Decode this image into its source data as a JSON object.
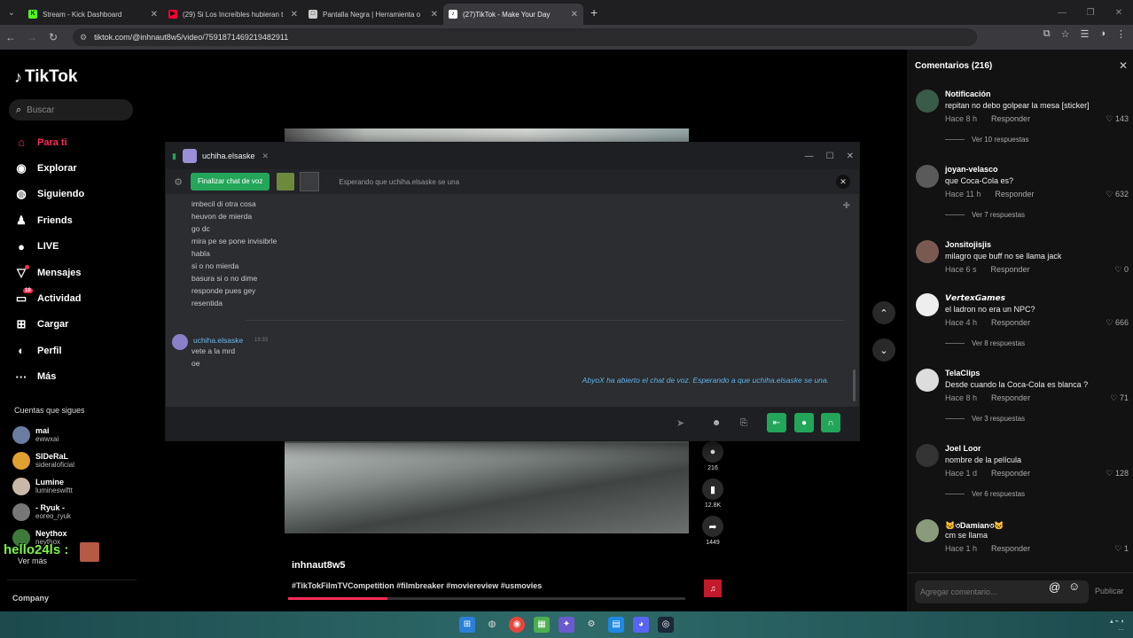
{
  "browser": {
    "tabs": [
      {
        "title": "Stream - Kick Dashboard",
        "fav_color": "#53fc18",
        "fav_text": "K"
      },
      {
        "title": "(29) Si Los Increíbles hubieran t",
        "fav_color": "#ff0033",
        "fav_text": "▶"
      },
      {
        "title": "Pantalla Negra | Herramienta o",
        "fav_color": "#cccccc",
        "fav_text": "□"
      },
      {
        "title": "(27)TikTok - Make Your Day",
        "fav_color": "#ffffff",
        "fav_text": "♪"
      }
    ],
    "url": "tiktok.com/@inhnaut8w5/video/7591871469219482911"
  },
  "sidebar": {
    "logo": "TikTok",
    "search_placeholder": "Buscar",
    "menu": [
      {
        "label": "Para ti",
        "icon": "home-icon",
        "glyph": "⌂",
        "selected": true
      },
      {
        "label": "Explorar",
        "icon": "compass-icon",
        "glyph": "◉"
      },
      {
        "label": "Siguiendo",
        "icon": "following-icon",
        "glyph": "◍"
      },
      {
        "label": "Friends",
        "icon": "friends-icon",
        "glyph": "♟"
      },
      {
        "label": "LIVE",
        "icon": "live-icon",
        "glyph": "●"
      },
      {
        "label": "Mensajes",
        "icon": "messages-icon",
        "glyph": "▽"
      },
      {
        "label": "Actividad",
        "icon": "activity-icon",
        "glyph": "▭",
        "badge": "10"
      },
      {
        "label": "Cargar",
        "icon": "upload-icon",
        "glyph": "⊞"
      },
      {
        "label": "Perfil",
        "icon": "profile-icon",
        "glyph": "◐"
      },
      {
        "label": "Más",
        "icon": "more-icon",
        "glyph": "···"
      }
    ],
    "following_header": "Cuentas que sigues",
    "following": [
      {
        "name": "mai",
        "handle": "ewwxai",
        "color": "#6a7ca0"
      },
      {
        "name": "SIDeRaL",
        "handle": "sideraloficial",
        "color": "#e2a030"
      },
      {
        "name": "Lumine",
        "handle": "lumineswiftt",
        "color": "#c9b8a8"
      },
      {
        "name": "- Ryuk -",
        "handle": "eoreo_ryuk",
        "color": "#777777"
      },
      {
        "name": "Neythox",
        "handle": "neythox",
        "color": "#3d7a3a"
      }
    ],
    "see_more": "Ver más",
    "overlay_text": "hello24ls :",
    "company": "Company"
  },
  "video": {
    "author": "inhnaut8w5",
    "caption": "#TikTokFilmTVCompetition #filmbreaker #moviereview #usmovies",
    "progress": 0.25,
    "actions": [
      {
        "name": "comment-icon",
        "glyph": "●",
        "count": "216"
      },
      {
        "name": "bookmark-icon",
        "glyph": "▮",
        "count": "12.8K"
      },
      {
        "name": "share-icon",
        "glyph": "➦",
        "count": "1449"
      }
    ]
  },
  "discord": {
    "username": "uchiha.elsaske",
    "end_voice_label": "Finalizar chat de voz",
    "waiting_text": "Esperando que uchiha.elsaske se una",
    "lines": [
      "imbecil di otra cosa",
      "heuvon de mierda",
      "go dc",
      "mira pe se pone invisibrle",
      "habla",
      "si o no mierda",
      "basura si o no dime",
      "responde pues gey",
      "resentida"
    ],
    "last_author": "uchiha.elsaske",
    "last_time": "19:33",
    "last_lines": [
      "vete a la mrd",
      "oe"
    ],
    "system_message": "AbyoX ha abierto el chat de voz. Esperando a que uchiha.elsaske se una."
  },
  "comments": {
    "header": "Comentarios (216)",
    "reply_label": "Responder",
    "items": [
      {
        "user": "Notificación",
        "text": "repitan no debo golpear la mesa [sticker]",
        "time": "Hace 8 h",
        "likes": "143",
        "more": "Ver 10 respuestas",
        "color": "#3a5a4a"
      },
      {
        "user": "joyan-velasco",
        "text": "que Coca-Cola es?",
        "time": "Hace 11 h",
        "likes": "632",
        "more": "Ver 7 respuestas",
        "color": "#5a5a5a"
      },
      {
        "user": "Jonsitojisjis",
        "text": "milagro que buff no se llama jack",
        "time": "Hace 6 s",
        "likes": "0",
        "more": "",
        "color": "#7a5a50"
      },
      {
        "user": "𝙑𝙚𝙧𝙩𝙚𝙭𝙂𝙖𝙢𝙚𝙨",
        "text": "el ladron no era un NPC?",
        "time": "Hace 4 h",
        "likes": "666",
        "more": "Ver 8 respuestas",
        "color": "#eeeeee"
      },
      {
        "user": "TelaClips",
        "text": "Desde cuando la Coca-Cola es blanca ?",
        "time": "Hace 8 h",
        "likes": "71",
        "more": "Ver 3 respuestas",
        "color": "#dddddd"
      },
      {
        "user": "Joel Loor",
        "text": "nombre de la película",
        "time": "Hace 1 d",
        "likes": "128",
        "more": "Ver 6 respuestas",
        "color": "#333333"
      },
      {
        "user": "🐱৩Damian৩🐱",
        "text": "cm se llama",
        "time": "Hace 1 h",
        "likes": "1",
        "more": "",
        "color": "#8a9a7a"
      }
    ],
    "input_placeholder": "Agregar comentario...",
    "post_label": "Publicar"
  }
}
